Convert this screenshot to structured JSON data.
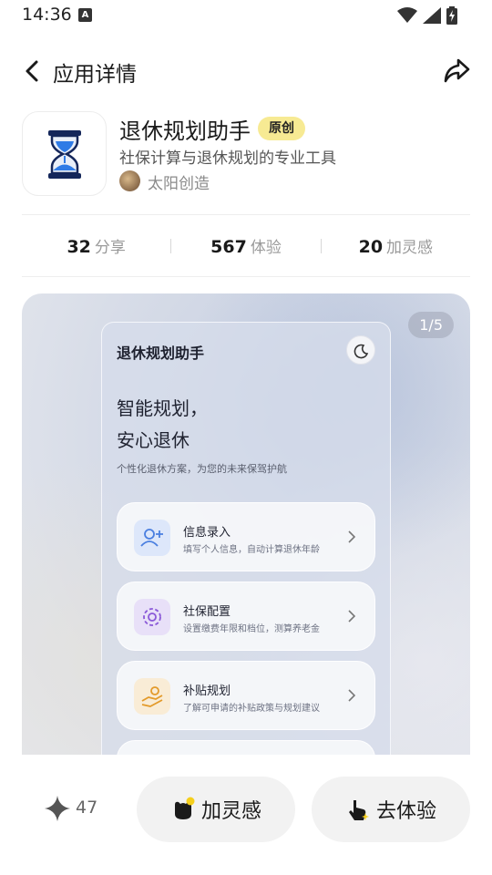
{
  "status_bar": {
    "time": "14:36",
    "notification_icon": "a-badge-icon",
    "right_icons": [
      "wifi-icon",
      "signal-icon",
      "battery-charging-icon"
    ]
  },
  "header": {
    "title": "应用详情"
  },
  "app": {
    "name": "退休规划助手",
    "badge": "原创",
    "description": "社保计算与退休规划的专业工具",
    "creator": "太阳创造",
    "icon": "hourglass-icon"
  },
  "stats": [
    {
      "value": "32",
      "label": "分享"
    },
    {
      "value": "567",
      "label": "体验"
    },
    {
      "value": "20",
      "label": "加灵感"
    }
  ],
  "preview": {
    "page_indicator": "1/5",
    "screen": {
      "title": "退休规划助手",
      "slogan_line1": "智能规划，",
      "slogan_line2": "安心退休",
      "subtitle": "个性化退休方案，为您的未来保驾护航",
      "menu": [
        {
          "title": "信息录入",
          "subtitle": "填写个人信息，自动计算退休年龄",
          "icon": "add-user-icon",
          "color": "#4a7fe0",
          "bg": "#dde7fa"
        },
        {
          "title": "社保配置",
          "subtitle": "设置缴费年限和档位，测算养老金",
          "icon": "gear-icon",
          "color": "#8a58d8",
          "bg": "#e8e0f8"
        },
        {
          "title": "补贴规划",
          "subtitle": "了解可申请的补贴政策与规划建议",
          "icon": "hand-coin-icon",
          "color": "#e39a2a",
          "bg": "#f9ecd6"
        }
      ]
    }
  },
  "bottom_bar": {
    "like_count": "47",
    "inspire_label": "加灵感",
    "try_label": "去体验"
  },
  "colors": {
    "badge_bg": "#f7ea93",
    "hourglass_frame": "#14265a",
    "hourglass_sand": "#2f7be6",
    "pill_bg": "#f2f2f2"
  }
}
